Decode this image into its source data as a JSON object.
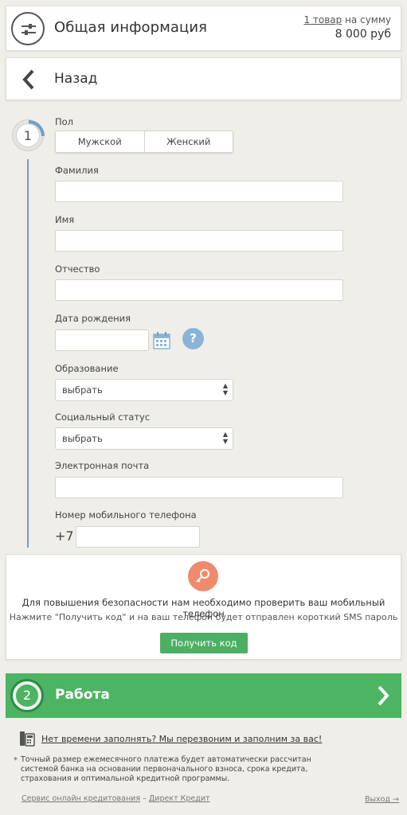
{
  "header": {
    "title": "Общая информация",
    "cart_link": "1 товар",
    "cart_suffix": " на сумму",
    "sum": "8 000 руб",
    "icon": "sliders-icon"
  },
  "nav": {
    "back_label": "Назад",
    "icon": "chevron-left-icon"
  },
  "step1": {
    "number": "1",
    "gender": {
      "label": "Пол",
      "options": [
        "Мужской",
        "Женский"
      ]
    },
    "surname": {
      "label": "Фамилия",
      "value": ""
    },
    "name": {
      "label": "Имя",
      "value": ""
    },
    "patronymic": {
      "label": "Отчество",
      "value": ""
    },
    "birthdate": {
      "label": "Дата рождения",
      "value": "",
      "help": "?"
    },
    "education": {
      "label": "Образование",
      "selected": "выбрать"
    },
    "social_status": {
      "label": "Социальный статус",
      "selected": "выбрать"
    },
    "email": {
      "label": "Электронная почта",
      "value": ""
    },
    "phone": {
      "label": "Номер мобильного телефона",
      "prefix": "+7",
      "value": ""
    }
  },
  "sms": {
    "title": "Для повышения безопасности нам необходимо проверить ваш мобильный телефон",
    "subtitle": "Нажмите \"Получить код\" и на ваш телефон будет отправлен короткий SMS пароль",
    "button": "Получить код",
    "icon": "key-icon"
  },
  "step2": {
    "number": "2",
    "title": "Работа"
  },
  "callback": {
    "text": "Нет времени заполнять? Мы перезвоним и заполним за вас!",
    "icon": "phone-icon"
  },
  "note": {
    "star": "*",
    "text": "Точный размер ежемесячного платежа будет автоматически рассчитан системой банка на основании первоначального взноса, срока кредита, страхования и оптимальной кредитной программы."
  },
  "footer": {
    "service": "Сервис онлайн кредитования",
    "separator": " – ",
    "brand": "Директ Кредит",
    "exit": "Выход →"
  },
  "colors": {
    "accent_green": "#4cb462",
    "step_line_blue": "#6f9fc9",
    "help_blue": "#8ab4d6",
    "key_orange": "#f08a6c"
  }
}
